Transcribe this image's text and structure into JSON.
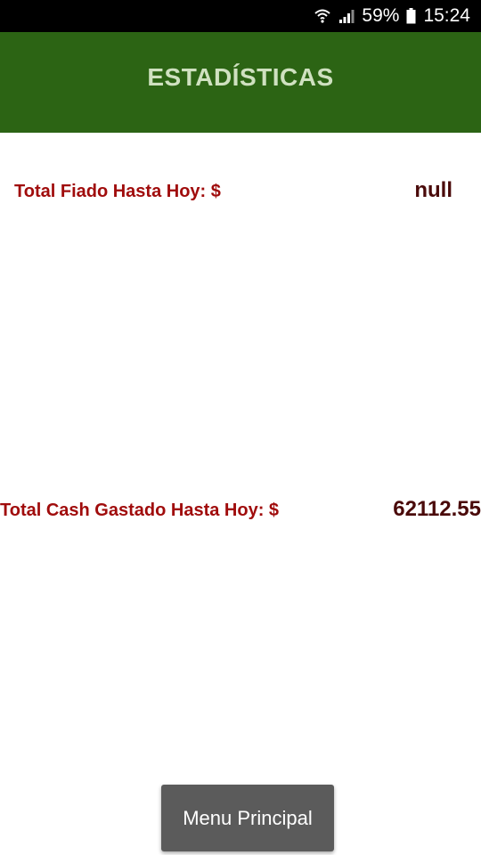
{
  "status_bar": {
    "battery_percent": "59%",
    "time": "15:24",
    "icons": [
      "wifi-icon",
      "signal-icon",
      "battery-icon"
    ]
  },
  "header": {
    "title": "ESTADÍSTICAS"
  },
  "stats": {
    "fiado_label": "Total Fiado Hasta Hoy: $",
    "fiado_value": "null",
    "cash_label": "Total Cash Gastado Hasta Hoy: $",
    "cash_value": "62112.55"
  },
  "footer": {
    "menu_button_label": "Menu Principal"
  },
  "colors": {
    "header_bg": "#2c6414",
    "header_text": "#cfe1c0",
    "label_red": "#a00c0c",
    "value_dark": "#4a0a0a",
    "button_bg": "#5b5b5b"
  }
}
